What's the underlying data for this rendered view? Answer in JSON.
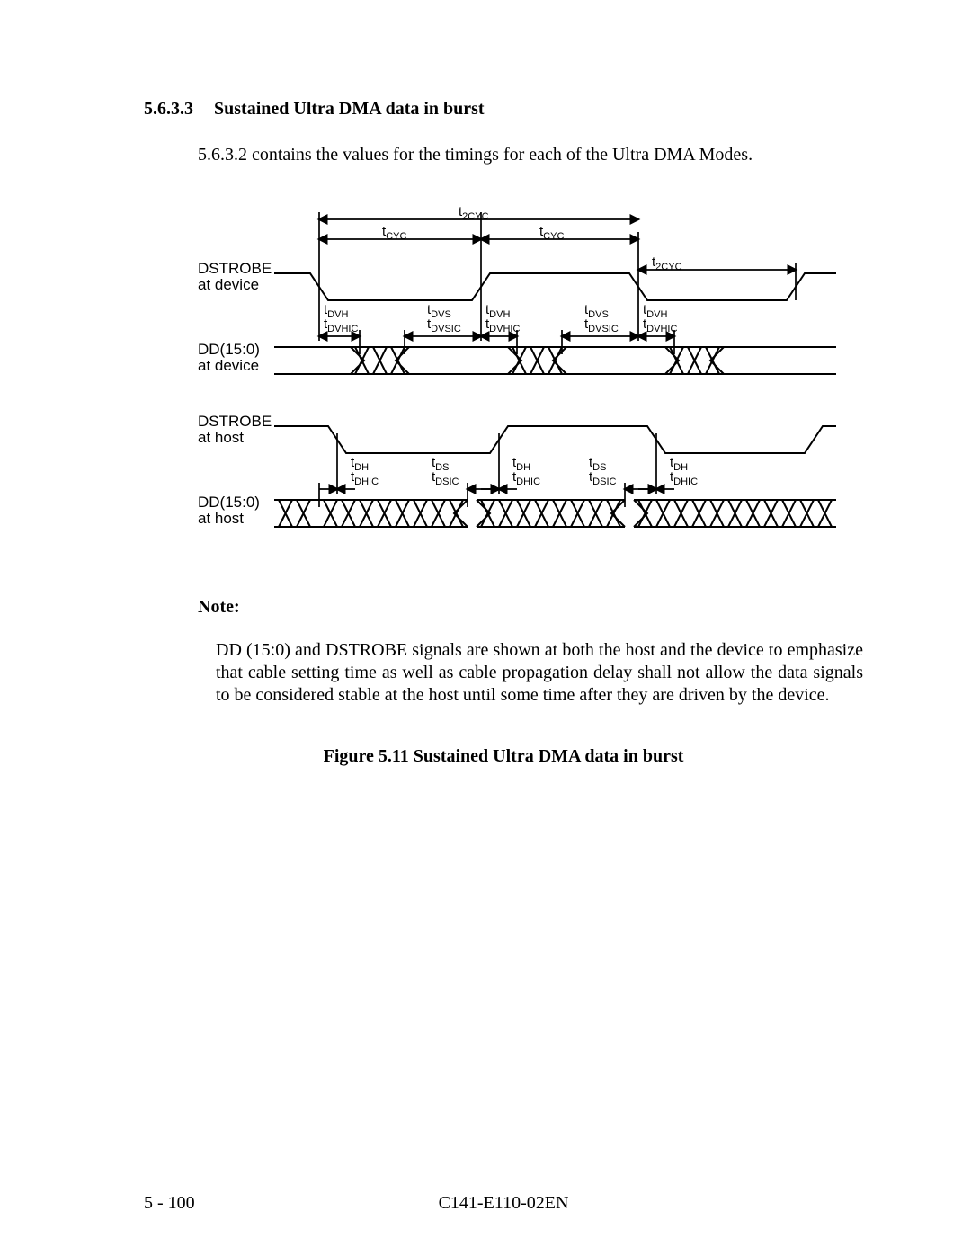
{
  "section_number": "5.6.3.3",
  "section_title": "Sustained Ultra DMA data in burst",
  "intro_text": "5.6.3.2 contains the values for the timings for each of the Ultra DMA Modes.",
  "note_heading": "Note:",
  "note_body": "DD (15:0) and DSTROBE signals are shown at both the host and the device to emphasize that cable setting time as well as cable propagation delay shall not allow the data signals to be considered stable at the host until some time after they are driven by the device.",
  "figure_caption": "Figure 5.11   Sustained Ultra DMA data in burst",
  "page_number": "5 - 100",
  "doc_id": "C141-E110-02EN",
  "diagram": {
    "signals": {
      "dstrobe_device": {
        "label1": "DSTROBE",
        "label2": "at device"
      },
      "dd_device": {
        "label1": "DD(15:0)",
        "label2": "at device"
      },
      "dstrobe_host": {
        "label1": "DSTROBE",
        "label2": "at host"
      },
      "dd_host": {
        "label1": "DD(15:0)",
        "label2": "at host"
      }
    },
    "timing_labels": {
      "t2cyc": {
        "base": "t",
        "sub": "2CYC"
      },
      "tcyc": {
        "base": "t",
        "sub": "CYC"
      },
      "tdvh": {
        "base": "t",
        "sub": "DVH"
      },
      "tdvhic": {
        "base": "t",
        "sub": "DVHIC"
      },
      "tdvs": {
        "base": "t",
        "sub": "DVS"
      },
      "tdvsic": {
        "base": "t",
        "sub": "DVSIC"
      },
      "tdh": {
        "base": "t",
        "sub": "DH"
      },
      "tdhic": {
        "base": "t",
        "sub": "DHIC"
      },
      "tds": {
        "base": "t",
        "sub": "DS"
      },
      "tdsic": {
        "base": "t",
        "sub": "DSIC"
      }
    }
  }
}
